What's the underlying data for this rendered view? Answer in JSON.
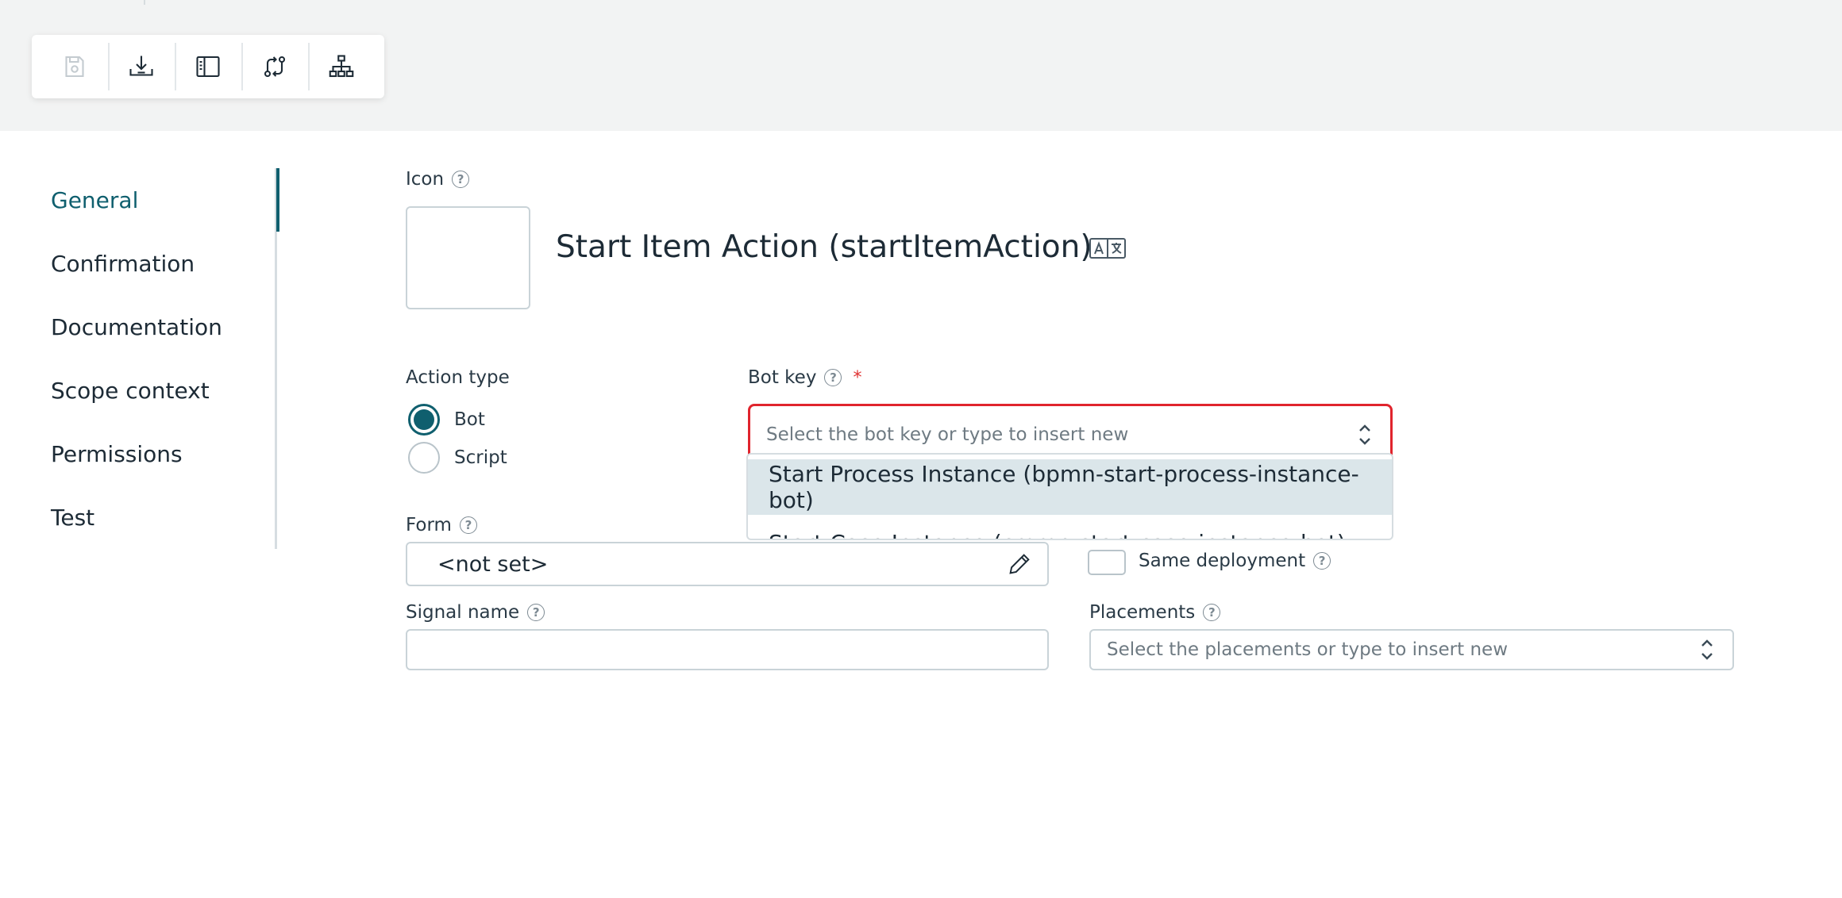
{
  "toolbar": {
    "buttons": [
      {
        "icon": "save-icon",
        "enabled": false
      },
      {
        "icon": "download-icon",
        "enabled": true
      },
      {
        "icon": "sidebar-panel-icon",
        "enabled": true
      },
      {
        "icon": "compare-arrows-icon",
        "enabled": true
      },
      {
        "icon": "hierarchy-icon",
        "enabled": true
      }
    ]
  },
  "sidenav": {
    "items": [
      {
        "label": "General",
        "active": true
      },
      {
        "label": "Confirmation",
        "active": false
      },
      {
        "label": "Documentation",
        "active": false
      },
      {
        "label": "Scope context",
        "active": false
      },
      {
        "label": "Permissions",
        "active": false
      },
      {
        "label": "Test",
        "active": false
      }
    ]
  },
  "header": {
    "icon_label": "Icon",
    "title": "Start Item Action (startItemAction)",
    "translate_icon": "translate-icon"
  },
  "action_type": {
    "label": "Action type",
    "options": [
      {
        "label": "Bot",
        "checked": true
      },
      {
        "label": "Script",
        "checked": false
      }
    ]
  },
  "bot_key": {
    "label": "Bot key",
    "required_mark": "*",
    "placeholder": "Select the bot key or type to insert new",
    "options": [
      "Start Process Instance (bpmn-start-process-instance-bot)",
      "Start Case Instance (cmmn-start-case-instance-bot)"
    ]
  },
  "form": {
    "label": "Form",
    "value": "<not set>"
  },
  "same_deployment": {
    "label": "Same deployment",
    "checked": false
  },
  "signal_name": {
    "label": "Signal name",
    "value": ""
  },
  "placements": {
    "label": "Placements",
    "placeholder": "Select the placements or type to insert new"
  },
  "help_glyph": "?",
  "colors": {
    "accent": "#0f5f6e",
    "error": "#e0242d",
    "highlight": "#dbe6ea"
  }
}
